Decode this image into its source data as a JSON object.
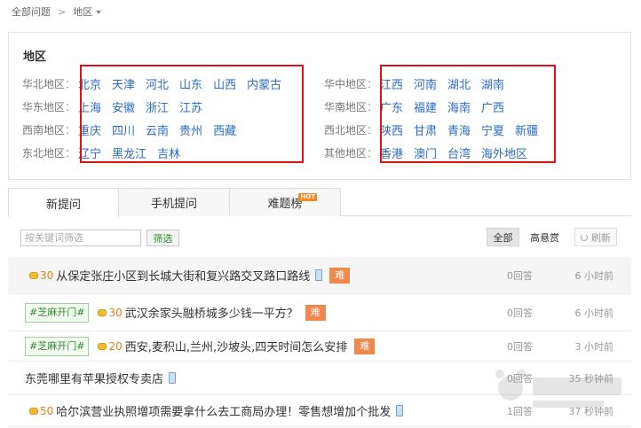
{
  "breadcrumb": {
    "home": "全部问题",
    "separator": ">",
    "current": "地区"
  },
  "region": {
    "title": "地区",
    "left_groups": [
      {
        "label": "华北地区",
        "cities": [
          "北京",
          "天津",
          "河北",
          "山东",
          "山西",
          "内蒙古"
        ]
      },
      {
        "label": "华东地区",
        "cities": [
          "上海",
          "安徽",
          "浙江",
          "江苏"
        ]
      },
      {
        "label": "西南地区",
        "cities": [
          "重庆",
          "四川",
          "云南",
          "贵州",
          "西藏"
        ]
      },
      {
        "label": "东北地区",
        "cities": [
          "辽宁",
          "黑龙江",
          "吉林"
        ]
      }
    ],
    "right_groups": [
      {
        "label": "华中地区",
        "cities": [
          "江西",
          "河南",
          "湖北",
          "湖南"
        ]
      },
      {
        "label": "华南地区",
        "cities": [
          "广东",
          "福建",
          "海南",
          "广西"
        ]
      },
      {
        "label": "西北地区",
        "cities": [
          "陕西",
          "甘肃",
          "青海",
          "宁夏",
          "新疆"
        ]
      },
      {
        "label": "其他地区",
        "cities": [
          "香港",
          "澳门",
          "台湾",
          "海外地区"
        ]
      }
    ],
    "colon": "："
  },
  "tabs": [
    {
      "label": "新提问",
      "active": true
    },
    {
      "label": "手机提问",
      "active": false
    },
    {
      "label": "难题榜",
      "active": false,
      "badge": "HOT"
    }
  ],
  "filter": {
    "placeholder": "按关键词筛选",
    "button": "筛选"
  },
  "sort": {
    "all": "全部",
    "reward": "高悬赏",
    "refresh": "刷新"
  },
  "questions": [
    {
      "tag": "",
      "reward": "30",
      "title": "从保定张庄小区到长城大街和复兴路交叉路口路线",
      "mobile": true,
      "hard": "难",
      "answers": "0回答",
      "time": "6 小时前"
    },
    {
      "tag": "#芝麻开门#",
      "reward": "30",
      "title": "武汉余家头融桥城多少钱一平方？",
      "mobile": false,
      "hard": "难",
      "answers": "0回答",
      "time": "6 小时前"
    },
    {
      "tag": "#芝麻开门#",
      "reward": "20",
      "title": "西安,麦积山,兰州,沙坡头,四天时间怎么安排",
      "mobile": false,
      "hard": "难",
      "answers": "0回答",
      "time": "3 小时前"
    },
    {
      "tag": "",
      "reward": "",
      "title": "东莞哪里有苹果授权专卖店",
      "mobile": true,
      "hard": "",
      "answers": "0回答",
      "time": "35 秒钟前"
    },
    {
      "tag": "",
      "reward": "50",
      "title": "哈尔滨营业执照增项需要拿什么去工商局办理！零售想增加个批发",
      "mobile": true,
      "hard": "",
      "answers": "1回答",
      "time": "37 秒钟前"
    }
  ],
  "icons": {
    "caret": "chevron-down-icon",
    "coin": "coin-icon",
    "mobile": "mobile-phone-icon",
    "refresh": "refresh-icon"
  },
  "colors": {
    "link": "#2b6cc2",
    "highlight_frame": "#d7141a",
    "reward": "#e57f1e",
    "hard_badge": "#f0874d",
    "tag_green": "#2e8b2e"
  }
}
